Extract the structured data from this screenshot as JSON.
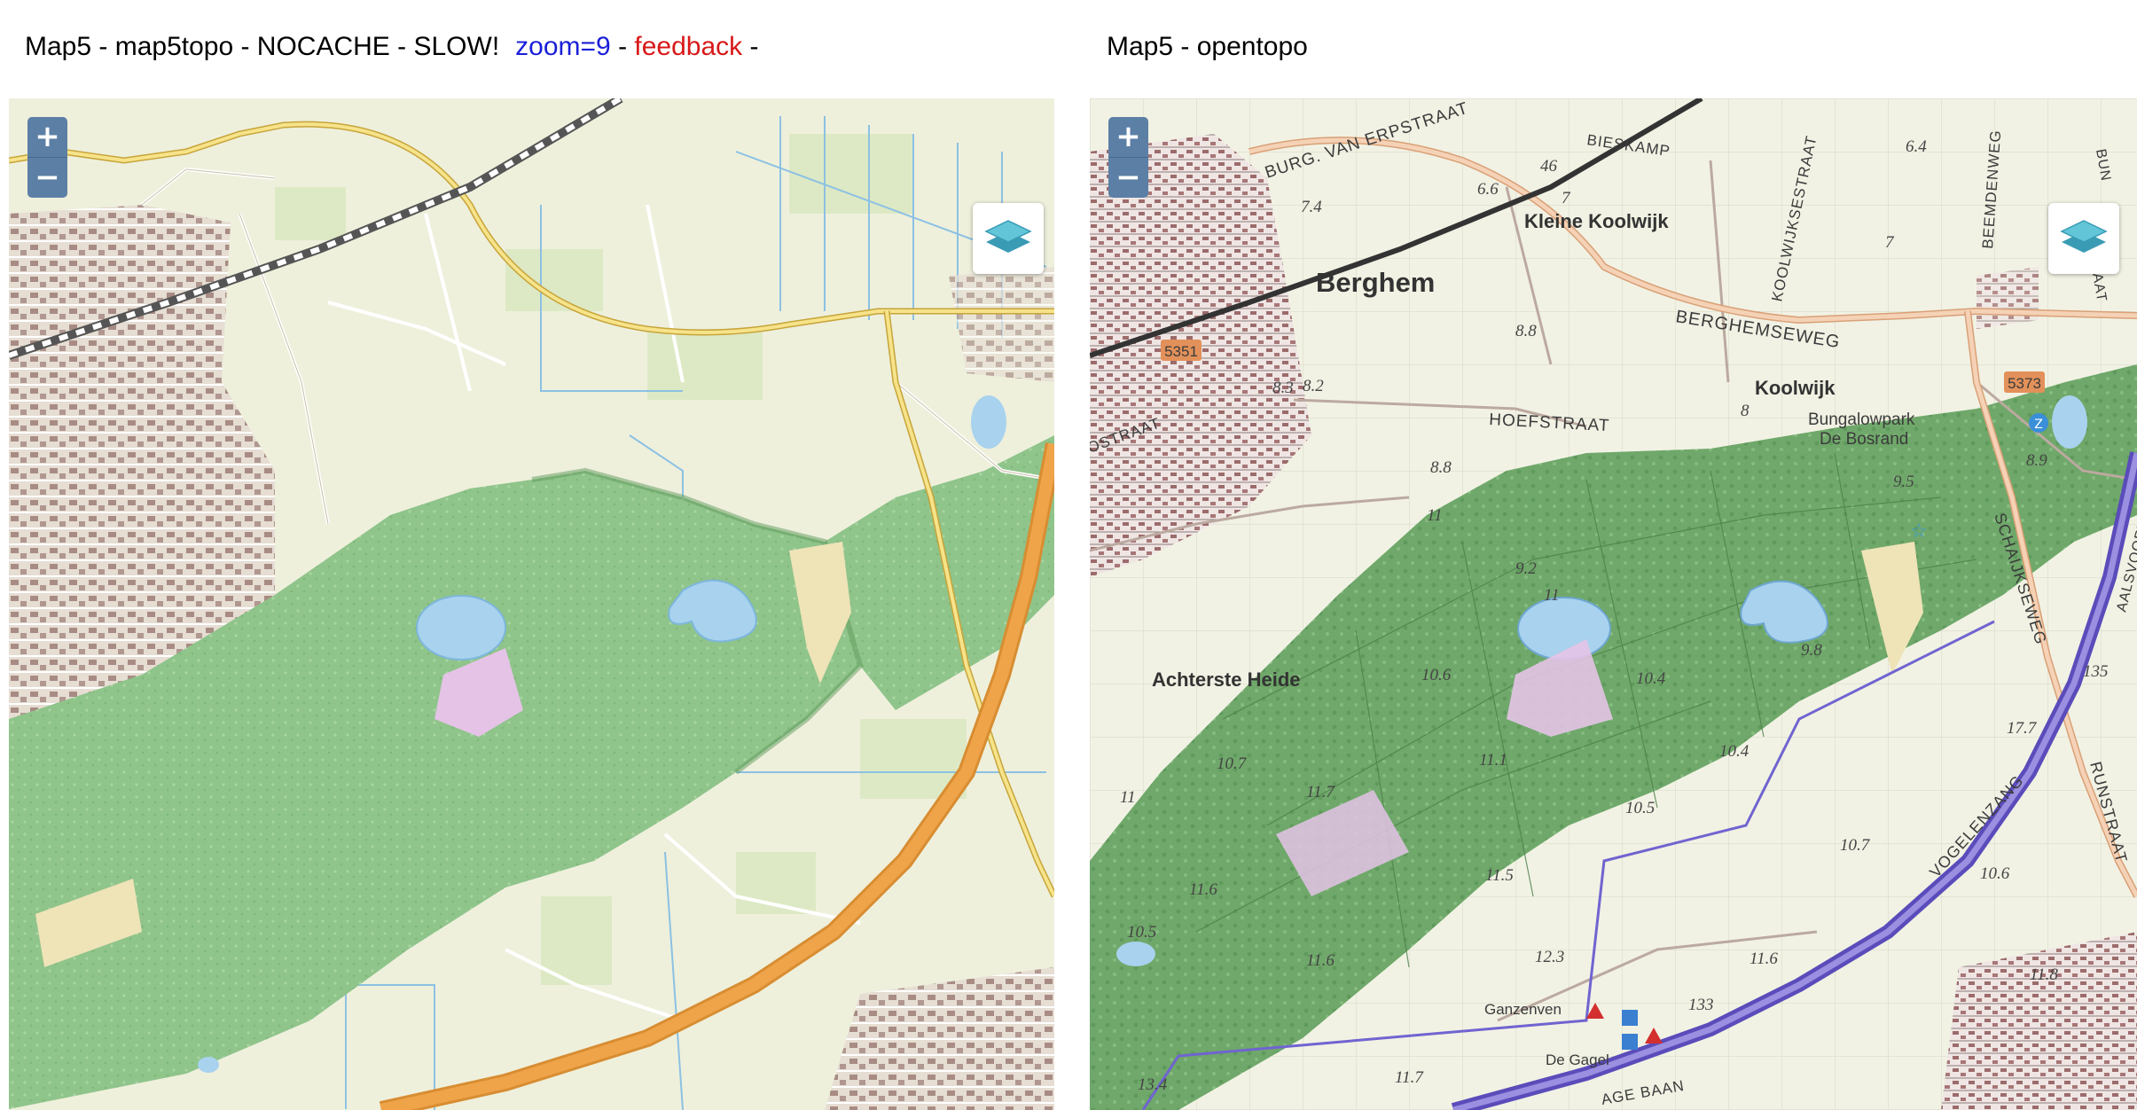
{
  "left_header": {
    "title": "Map5 - map5topo - NOCACHE - SLOW!",
    "zoom_link": "zoom=9",
    "sep1": " - ",
    "feedback_link": "feedback",
    "sep2": " -"
  },
  "right_header": {
    "title": "Map5 - opentopo"
  },
  "zoom_controls": {
    "zoom_in": "+",
    "zoom_out": "−"
  },
  "colors": {
    "forest": "#8fc48a",
    "forest_dark": "#5f9a5c",
    "water": "#a8d2ee",
    "heath": "#e4c3e6",
    "farmland": "#eef0dc",
    "highway": "#f0a44a",
    "motorway_purple": "#6a5cc8",
    "link_zoom": "#1a1fd8",
    "link_feedback": "#d81818"
  },
  "opentopo_labels": {
    "places": [
      "Berghem",
      "Kleine Koolwijk",
      "Koolwijk",
      "Achterste Heide",
      "Bungalowpark",
      "De Bosrand",
      "Ganzenven",
      "De Gagel"
    ],
    "streets": [
      "BURG. VAN ERPSTRAAT",
      "BIESKAMP",
      "KOOLWIJKSESTRAAT",
      "BEEMDENWEG",
      "BERGHEMSEWEG",
      "HOEFSTRAAT",
      "SCHAIJKSEWEG",
      "VOGELENZANG",
      "RUNSTRAAT",
      "AALSVOORT",
      "BUN",
      "AAT",
      "OSTRAAT",
      "AGE BAAN"
    ],
    "road_refs": [
      "5351",
      "5373"
    ],
    "heights": [
      "7.4",
      "6.6",
      "7",
      "6.4",
      "7",
      "8.8",
      "8.2",
      "8.3",
      "8",
      "8.9",
      "9.5",
      "8.8",
      "11",
      "9.2",
      "11",
      "10.6",
      "10.4",
      "9.8",
      "11.1",
      "10.7",
      "11.7",
      "10.4",
      "10.5",
      "11",
      "11.6",
      "11.5",
      "10.7",
      "10.6",
      "10.5",
      "11.6",
      "12.3",
      "11.6",
      "11.8",
      "13.4",
      "11.7",
      "133",
      "135",
      "17.7",
      "46"
    ]
  }
}
